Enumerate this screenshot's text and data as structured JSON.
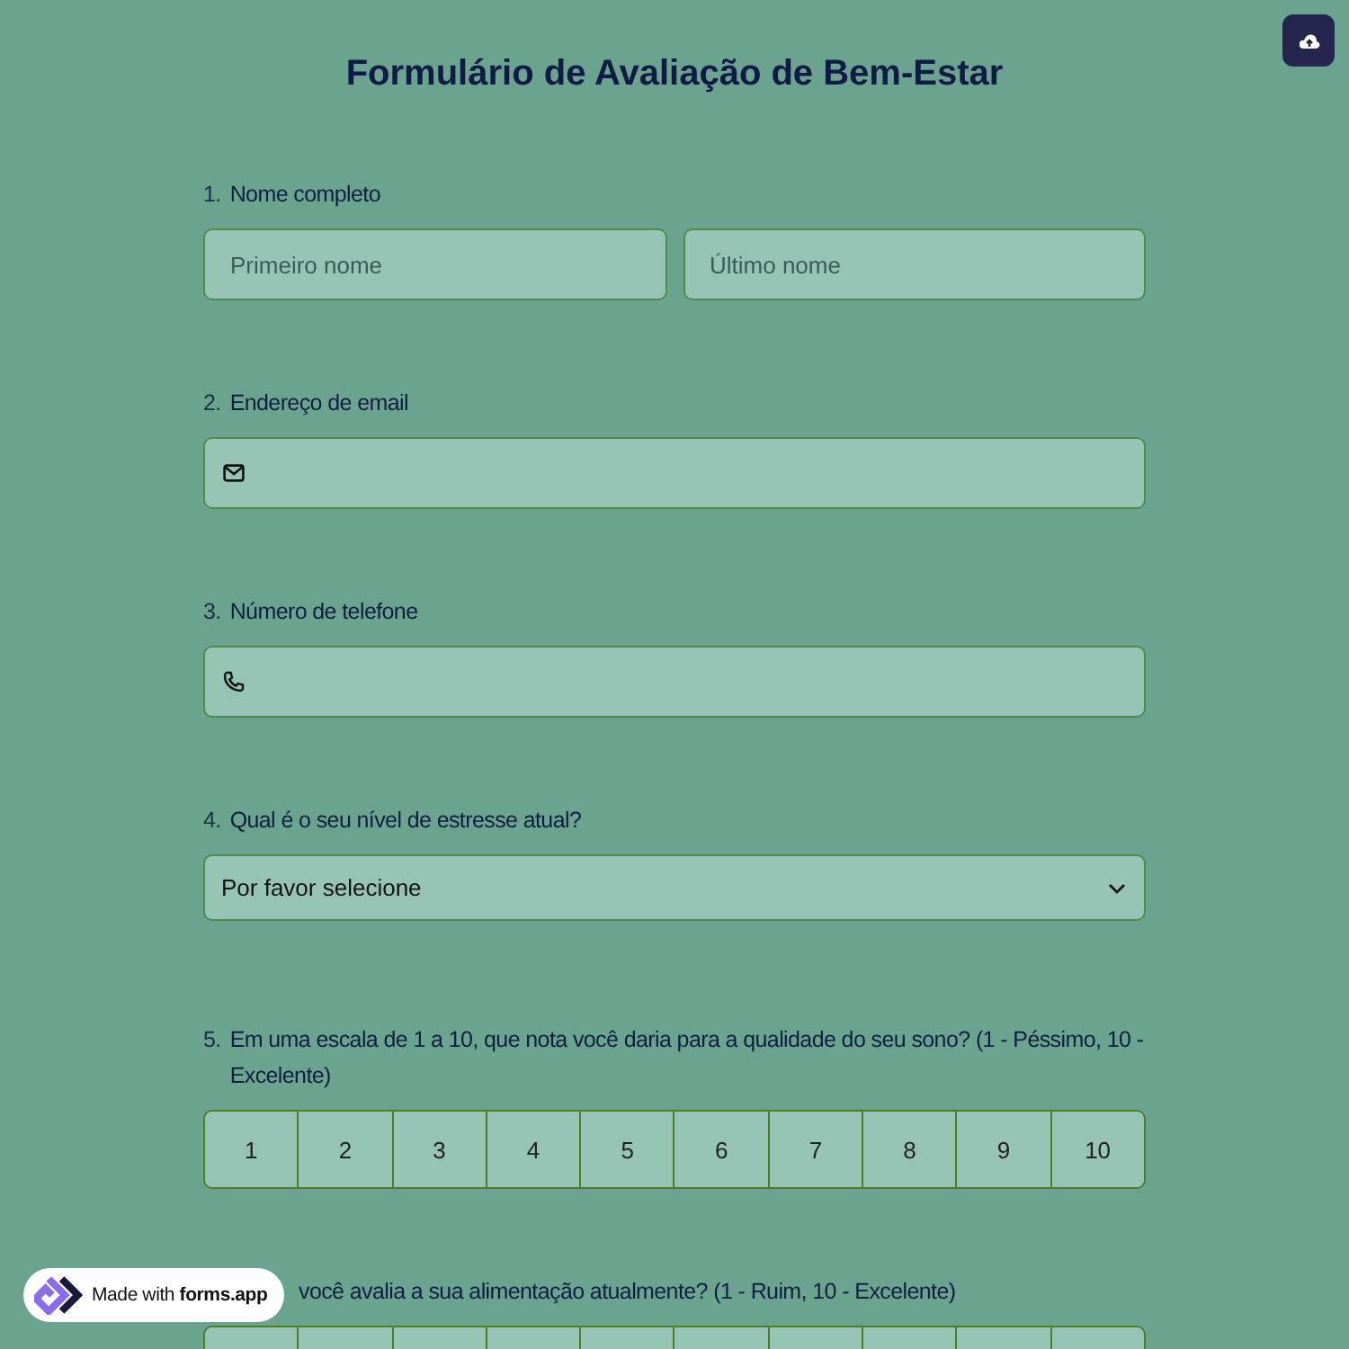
{
  "title": "Formulário de Avaliação de Bem-Estar",
  "questions": [
    {
      "kind": "name",
      "number": "1.",
      "label": "Nome completo",
      "fields": [
        {
          "placeholder": "Primeiro nome"
        },
        {
          "placeholder": "Último nome"
        }
      ]
    },
    {
      "kind": "email",
      "number": "2.",
      "label": "Endereço de email"
    },
    {
      "kind": "phone",
      "number": "3.",
      "label": "Número de telefone"
    },
    {
      "kind": "select",
      "number": "4.",
      "label": "Qual é o seu nível de estresse atual?",
      "value": "Por favor selecione"
    },
    {
      "kind": "scale",
      "number": "5.",
      "label": "Em uma escala de 1 a 10, que nota você daria para a qualidade do seu sono? (1 - Péssimo, 10 - Excelente)",
      "options": [
        {
          "label": "1",
          "selected": false
        },
        {
          "label": "2",
          "selected": false
        },
        {
          "label": "3",
          "selected": false
        },
        {
          "label": "4",
          "selected": false
        },
        {
          "label": "5",
          "selected": false
        },
        {
          "label": "6",
          "selected": false
        },
        {
          "label": "7",
          "selected": false
        },
        {
          "label": "8",
          "selected": false
        },
        {
          "label": "9",
          "selected": false
        },
        {
          "label": "10",
          "selected": false
        }
      ]
    },
    {
      "kind": "scale",
      "label": "você avalia a sua alimentação atualmente? (1 - Ruim, 10 - Excelente)",
      "options": [
        {
          "selected": false
        },
        {
          "selected": false
        },
        {
          "selected": false
        },
        {
          "selected": false
        },
        {
          "selected": false
        },
        {
          "selected": false
        },
        {
          "selected": false
        },
        {
          "selected": false
        },
        {
          "selected": false
        },
        {
          "selected": false
        }
      ]
    }
  ],
  "badge": {
    "text": "Made with **forms.app**"
  }
}
